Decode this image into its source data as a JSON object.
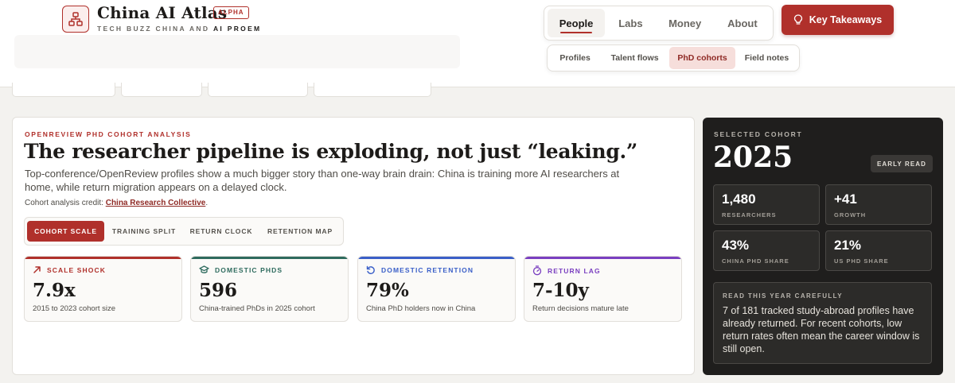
{
  "brand": {
    "title": "China AI Atlas",
    "badge": "ALPHA",
    "subtitle_prefix": "TECH BUZZ CHINA",
    "subtitle_and": "AND",
    "subtitle_suffix": "AI PROEM",
    "logo_icon": "network-icon"
  },
  "nav": {
    "primary": [
      {
        "label": "People",
        "active": true
      },
      {
        "label": "Labs",
        "active": false
      },
      {
        "label": "Money",
        "active": false
      },
      {
        "label": "About",
        "active": false
      }
    ],
    "secondary": [
      {
        "label": "Profiles",
        "active": false
      },
      {
        "label": "Talent flows",
        "active": false
      },
      {
        "label": "PhD cohorts",
        "active": true
      },
      {
        "label": "Field notes",
        "active": false
      }
    ],
    "cta": {
      "label": "Key Takeaways",
      "icon": "lightbulb-icon"
    }
  },
  "main": {
    "eyebrow": "OPENREVIEW PHD COHORT ANALYSIS",
    "headline": "The researcher pipeline is exploding, not just “leaking.”",
    "lede": "Top-conference/OpenReview profiles show a much bigger story than one-way brain drain: China is training more AI researchers at home, while return migration appears on a delayed clock.",
    "credit_prefix": "Cohort analysis credit: ",
    "credit_link": "China Research Collective",
    "credit_suffix": ".",
    "segments": [
      {
        "label": "COHORT SCALE",
        "active": true
      },
      {
        "label": "TRAINING SPLIT",
        "active": false
      },
      {
        "label": "RETURN CLOCK",
        "active": false
      },
      {
        "label": "RETENTION MAP",
        "active": false
      }
    ],
    "stats": [
      {
        "label": "SCALE SHOCK",
        "value": "7.9x",
        "caption": "2015 to 2023 cohort size",
        "color": "#b0302b",
        "icon": "arrow-up-right-icon"
      },
      {
        "label": "DOMESTIC PHDS",
        "value": "596",
        "caption": "China-trained PhDs in 2025 cohort",
        "color": "#2e6b5e",
        "icon": "graduation-cap-icon"
      },
      {
        "label": "DOMESTIC RETENTION",
        "value": "79%",
        "caption": "China PhD holders now in China",
        "color": "#3a5fc8",
        "icon": "refresh-icon"
      },
      {
        "label": "RETURN LAG",
        "value": "7-10y",
        "caption": "Return decisions mature late",
        "color": "#7a3fc0",
        "icon": "timer-icon"
      }
    ]
  },
  "cohort": {
    "eyebrow": "SELECTED COHORT",
    "year": "2025",
    "badge": "EARLY READ",
    "metrics": [
      {
        "value": "1,480",
        "label": "RESEARCHERS"
      },
      {
        "value": "+41",
        "label": "GROWTH"
      },
      {
        "value": "43%",
        "label": "CHINA PHD SHARE"
      },
      {
        "value": "21%",
        "label": "US PHD SHARE"
      }
    ],
    "note_title": "READ THIS YEAR CAREFULLY",
    "note_body": "7 of 181 tracked study-abroad profiles have already returned. For recent cohorts, low return rates often mean the career window is still open."
  }
}
